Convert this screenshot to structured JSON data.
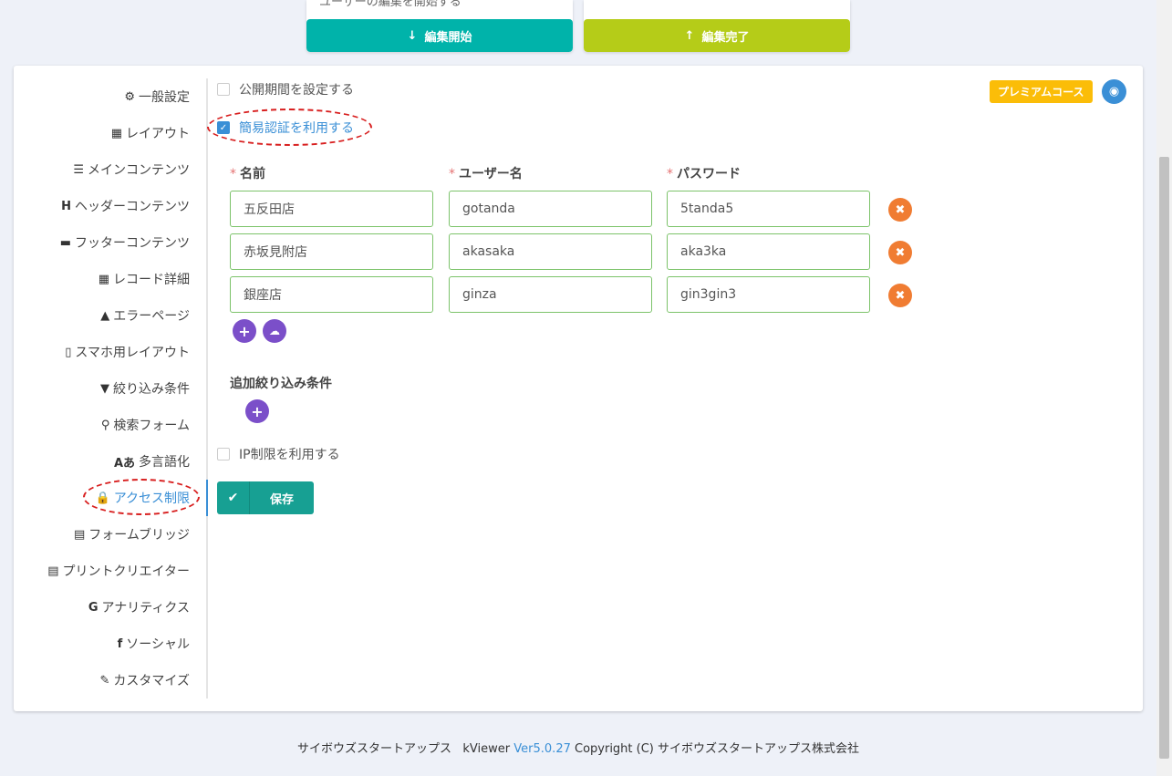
{
  "top": {
    "desc": "ユーザーの編集を開始する",
    "start_label": "編集開始",
    "finish_label": "編集完了",
    "start_color": "#00b3aa",
    "finish_color": "#b5cc18"
  },
  "sidebar": {
    "items": [
      {
        "icon": "⚙",
        "label": "一般設定"
      },
      {
        "icon": "▦",
        "label": "レイアウト"
      },
      {
        "icon": "☰",
        "label": "メインコンテンツ"
      },
      {
        "icon": "H",
        "label": "ヘッダーコンテンツ"
      },
      {
        "icon": "▬",
        "label": "フッターコンテンツ"
      },
      {
        "icon": "▦",
        "label": "レコード詳細"
      },
      {
        "icon": "▲",
        "label": "エラーページ"
      },
      {
        "icon": "▯",
        "label": "スマホ用レイアウト"
      },
      {
        "icon": "▼",
        "label": "絞り込み条件"
      },
      {
        "icon": "⚲",
        "label": "検索フォーム"
      },
      {
        "icon": "Aあ",
        "label": "多言語化"
      },
      {
        "icon": "🔒",
        "label": "アクセス制限"
      },
      {
        "icon": "▤",
        "label": "フォームブリッジ"
      },
      {
        "icon": "▤",
        "label": "プリントクリエイター"
      },
      {
        "icon": "G",
        "label": "アナリティクス"
      },
      {
        "icon": "f",
        "label": "ソーシャル"
      },
      {
        "icon": "✎",
        "label": "カスタマイズ"
      }
    ],
    "active": "アクセス制限"
  },
  "main": {
    "publish_period_label": "公開期間を設定する",
    "basic_auth_label": "簡易認証を利用する",
    "basic_auth_checked": true,
    "columns": {
      "name": "名前",
      "user": "ユーザー名",
      "password": "パスワード",
      "required_mark": "*"
    },
    "rows": [
      {
        "name": "五反田店",
        "user": "gotanda",
        "password": "5tanda5"
      },
      {
        "name": "赤坂見附店",
        "user": "akasaka",
        "password": "aka3ka"
      },
      {
        "name": "銀座店",
        "user": "ginza",
        "password": "gin3gin3"
      }
    ],
    "extra_filter_label": "追加絞り込み条件",
    "ip_label": "IP制限を利用する",
    "save_label": "保存",
    "premium_label": "プレミアムコース"
  },
  "footer": {
    "company": "サイボウズスタートアップス",
    "product": "kViewer",
    "version": "Ver5.0.27",
    "copyright": "Copyright (C) サイボウズスタートアップス株式会社"
  }
}
